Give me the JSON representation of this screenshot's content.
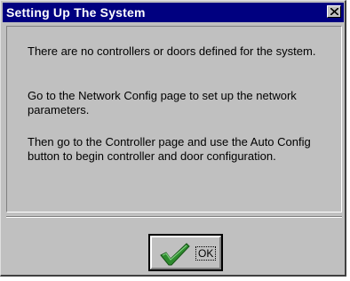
{
  "dialog": {
    "title": "Setting Up The System",
    "message_1": "There are no controllers or doors defined for the system.",
    "message_2": "Go to the Network Config page to set up the network parameters.",
    "message_3": "Then go to the Controller page and use the Auto Config button to begin controller and door configuration.",
    "ok_label": "OK"
  },
  "icons": {
    "close": "close-icon",
    "ok": "checkmark-icon"
  },
  "colors": {
    "titlebar": "#000080",
    "face": "#c0c0c0",
    "checkmark": "#2e8b2e"
  }
}
